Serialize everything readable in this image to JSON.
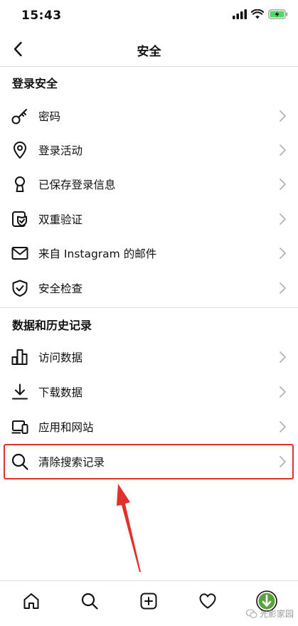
{
  "status_bar": {
    "time": "15:43"
  },
  "header": {
    "title": "安全",
    "back_icon": "chevron-left-icon"
  },
  "sections": [
    {
      "title": "登录安全",
      "items": [
        {
          "label": "密码",
          "icon": "key-icon"
        },
        {
          "label": "登录活动",
          "icon": "location-pin-icon"
        },
        {
          "label": "已保存登录信息",
          "icon": "keyhole-icon"
        },
        {
          "label": "双重验证",
          "icon": "shield-phone-icon"
        },
        {
          "label": "来自 Instagram 的邮件",
          "icon": "mail-icon"
        },
        {
          "label": "安全检查",
          "icon": "shield-check-icon"
        }
      ]
    },
    {
      "title": "数据和历史记录",
      "items": [
        {
          "label": "访问数据",
          "icon": "bar-chart-icon"
        },
        {
          "label": "下载数据",
          "icon": "download-icon"
        },
        {
          "label": "应用和网站",
          "icon": "devices-icon"
        },
        {
          "label": "清除搜索记录",
          "icon": "search-icon"
        }
      ]
    }
  ],
  "tab_bar": [
    "home-icon",
    "search-icon",
    "add-icon",
    "heart-icon",
    "profile-icon"
  ],
  "watermark": {
    "text": "光影家园"
  },
  "colors": {
    "annotation_red": "#e0322c",
    "divider": "#dbdbdb",
    "chevron": "#b3b3b3"
  }
}
